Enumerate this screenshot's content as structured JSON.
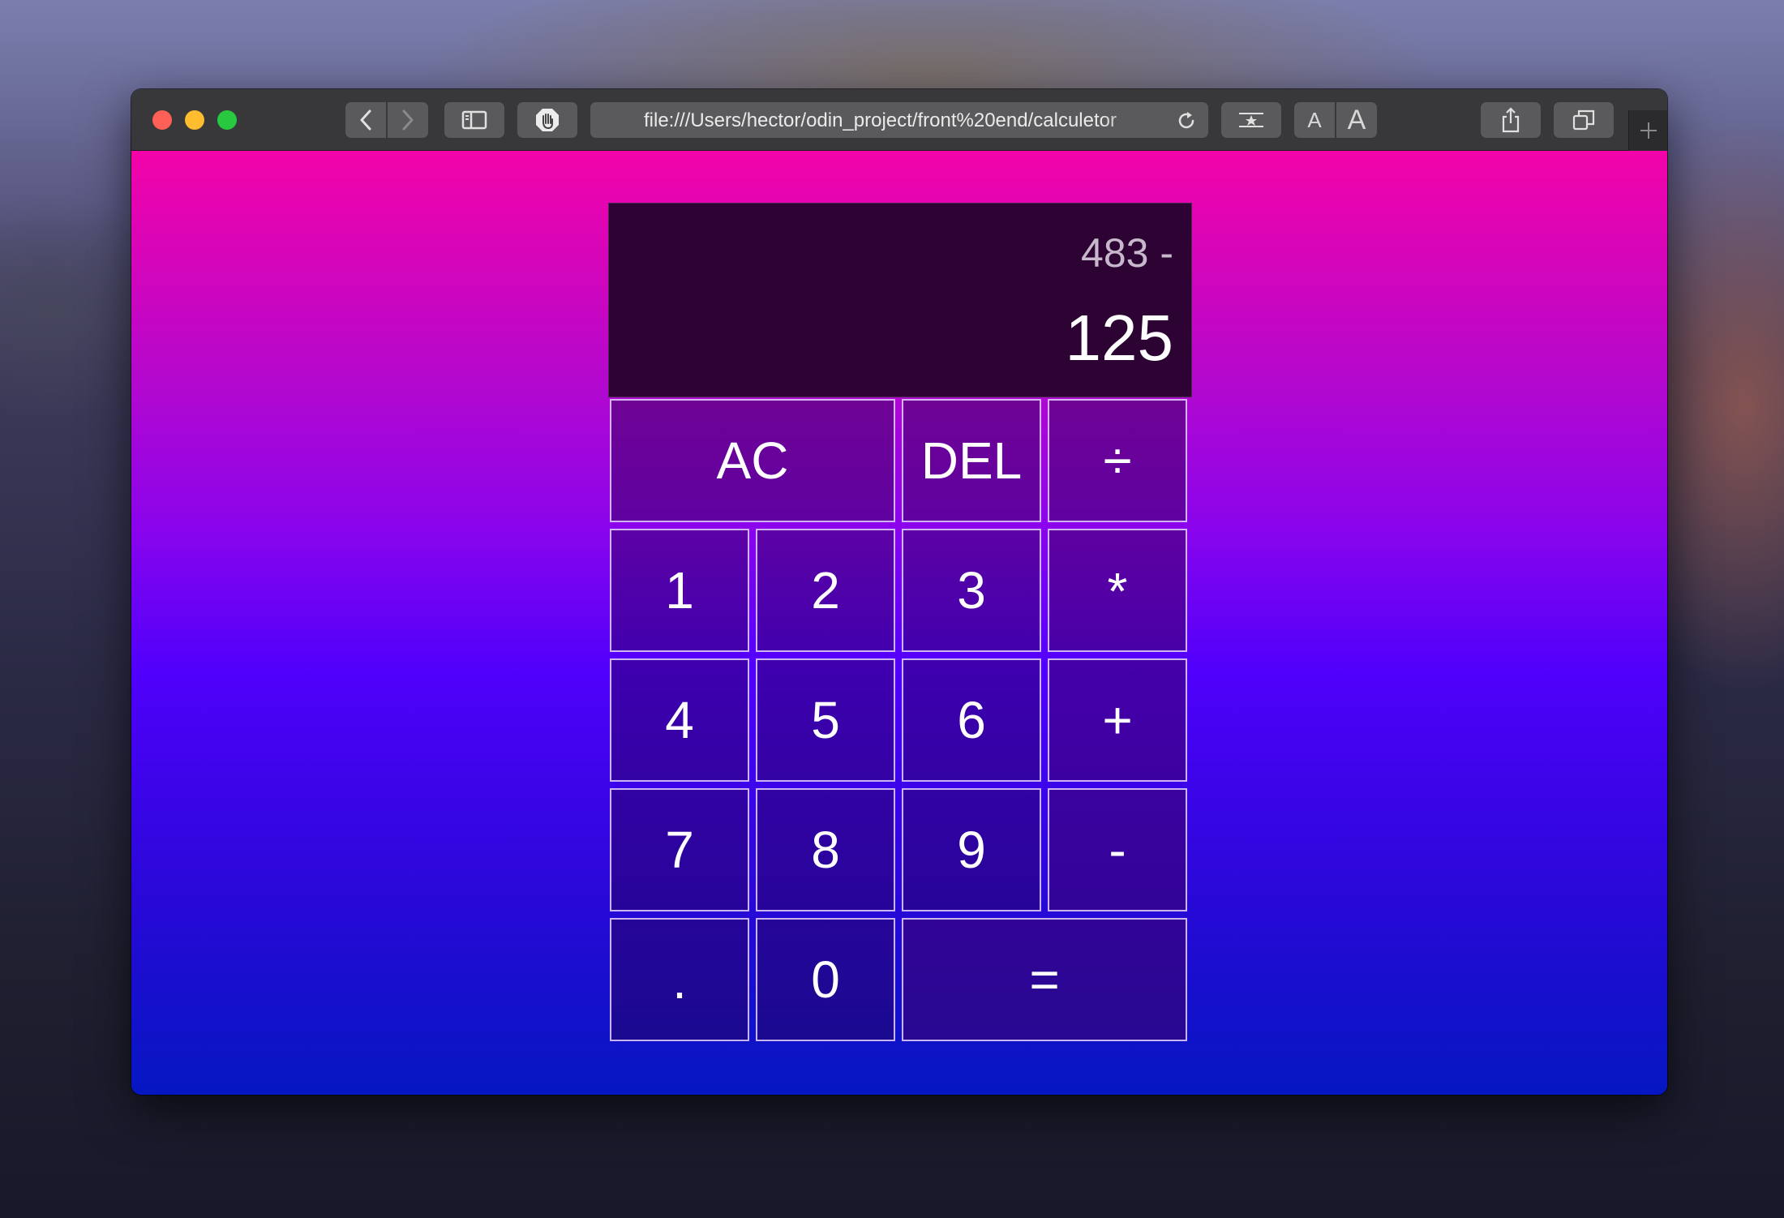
{
  "browser": {
    "url": "file:///Users/hector/odin_project/front%20end/calculetor",
    "reader_text_small": "A",
    "reader_text_large": "A"
  },
  "calculator": {
    "previous_operand": "483 -",
    "current_operand": "125",
    "keys": {
      "ac": "AC",
      "del": "DEL",
      "divide": "÷",
      "one": "1",
      "two": "2",
      "three": "3",
      "multiply": "*",
      "four": "4",
      "five": "5",
      "six": "6",
      "plus": "+",
      "seven": "7",
      "eight": "8",
      "nine": "9",
      "minus": "-",
      "decimal": ".",
      "zero": "0",
      "equals": "="
    }
  },
  "colors": {
    "traffic_close": "#fe5f57",
    "traffic_minimize": "#febc2e",
    "traffic_zoom": "#28c840",
    "gradient_top": "#f303a8",
    "gradient_mid": "#5000fb",
    "gradient_bottom": "#0517c2",
    "display_bg": "#2d0333"
  }
}
